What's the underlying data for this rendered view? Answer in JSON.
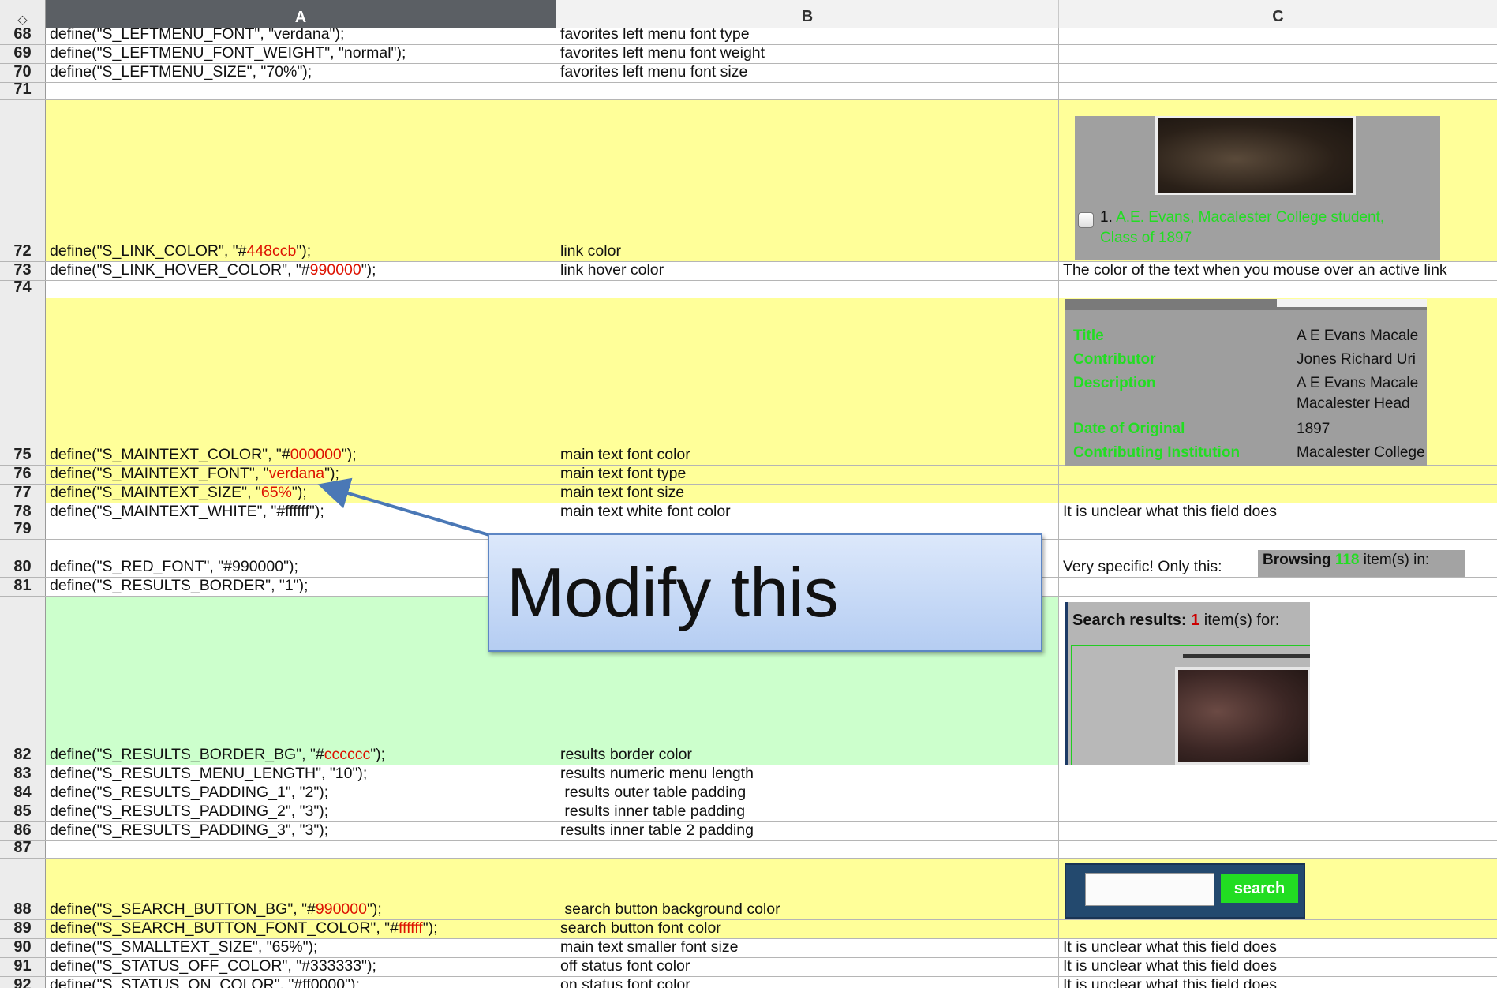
{
  "columns": {
    "corner": "◇",
    "a": "A",
    "b": "B",
    "c": "C"
  },
  "rows": {
    "r68": {
      "num": "68",
      "a": "define(\"S_LEFTMENU_FONT\", \"verdana\");",
      "b": "favorites left menu font type"
    },
    "r69": {
      "num": "69",
      "a": "define(\"S_LEFTMENU_FONT_WEIGHT\", \"normal\");",
      "b": "favorites left menu font weight"
    },
    "r70": {
      "num": "70",
      "a": "define(\"S_LEFTMENU_SIZE\", \"70%\");",
      "b": "favorites left menu font size"
    },
    "r71": {
      "num": "71"
    },
    "r72": {
      "num": "72",
      "a1": "define(\"S_LINK_COLOR\", \"#",
      "a2": "448ccb",
      "a3": "\");",
      "b": "link color"
    },
    "r73": {
      "num": "73",
      "a1": "define(\"S_LINK_HOVER_COLOR\", \"#",
      "a2": "990000",
      "a3": "\");",
      "b": "link hover color",
      "c": "The color of the text when you mouse over an active link"
    },
    "r74": {
      "num": "74"
    },
    "r75": {
      "num": "75",
      "a1": "define(\"S_MAINTEXT_COLOR\", \"#",
      "a2": "000000",
      "a3": "\");",
      "b": "main text font color"
    },
    "r76": {
      "num": "76",
      "a1": "define(\"S_MAINTEXT_FONT\", \"",
      "a2": "verdana",
      "a3": "\");",
      "b": "main text font type"
    },
    "r77": {
      "num": "77",
      "a1": "define(\"S_MAINTEXT_SIZE\", \"",
      "a2": "65%",
      "a3": "\");",
      "b": "main text font size"
    },
    "r78": {
      "num": "78",
      "a": "define(\"S_MAINTEXT_WHITE\", \"#ffffff\");",
      "b": "main text white font color",
      "c": "It is unclear what this field does"
    },
    "r79": {
      "num": "79"
    },
    "r80": {
      "num": "80",
      "a": "define(\"S_RED_FONT\", \"#990000\");",
      "c": "Very specific! Only this:"
    },
    "r81": {
      "num": "81",
      "a": "define(\"S_RESULTS_BORDER\", \"1\");"
    },
    "r82": {
      "num": "82",
      "a1": "define(\"S_RESULTS_BORDER_BG\", \"#",
      "a2": "cccccc",
      "a3": "\");",
      "b": "results border color"
    },
    "r83": {
      "num": "83",
      "a": "define(\"S_RESULTS_MENU_LENGTH\", \"10\");",
      "b": "results numeric menu length"
    },
    "r84": {
      "num": "84",
      "a": "define(\"S_RESULTS_PADDING_1\", \"2\");",
      "b": " results outer table padding"
    },
    "r85": {
      "num": "85",
      "a": "define(\"S_RESULTS_PADDING_2\", \"3\");",
      "b": " results inner table padding"
    },
    "r86": {
      "num": "86",
      "a": "define(\"S_RESULTS_PADDING_3\", \"3\");",
      "b": "results inner table 2 padding"
    },
    "r87": {
      "num": "87"
    },
    "r88": {
      "num": "88",
      "a1": "define(\"S_SEARCH_BUTTON_BG\", \"#",
      "a2": "990000",
      "a3": "\");",
      "b": " search button background color"
    },
    "r89": {
      "num": "89",
      "a1": "define(\"S_SEARCH_BUTTON_FONT_COLOR\", \"#",
      "a2": "ffffff",
      "a3": "\");",
      "b": "search button font color"
    },
    "r90": {
      "num": "90",
      "a": "define(\"S_SMALLTEXT_SIZE\", \"65%\");",
      "b": "main text smaller font size",
      "c": "It is unclear what this field does"
    },
    "r91": {
      "num": "91",
      "a": "define(\"S_STATUS_OFF_COLOR\", \"#333333\");",
      "b": "off status font color",
      "c": "It is unclear what this field does"
    },
    "r92": {
      "num": "92",
      "a": "define(\"S_STATUS_ON_COLOR\", \"#ff0000\");",
      "b": "on status font color",
      "c": "It is unclear what this field does"
    }
  },
  "preview_link": {
    "number": "1.",
    "text_line1": "A.E. Evans, Macalester College student,",
    "text_line2": "Class of 1897"
  },
  "preview_meta": [
    {
      "key": "Title",
      "value": "A E  Evans  Macale"
    },
    {
      "key": "Contributor",
      "value": "Jones  Richard Uri"
    },
    {
      "key": "Description",
      "value": "A E  Evans  Macale"
    },
    {
      "key": "",
      "value": "Macalester Head"
    },
    {
      "key": "Date of Original",
      "value": "1897"
    },
    {
      "key": "Contributing Institution",
      "value": "Macalester College"
    }
  ],
  "preview_browsing": {
    "label": "Browsing",
    "count": "118",
    "suffix": "item(s) in:"
  },
  "preview_results": {
    "label": "Search results:",
    "count": "1",
    "suffix": "item(s) for:"
  },
  "preview_search": {
    "button": "search"
  },
  "callout": {
    "text": "Modify this"
  },
  "colors": {
    "yellow": "#ffff99",
    "green": "#ccffcc",
    "header": "#5b5f64",
    "red": "#dd1100",
    "link_green": "#22dd22",
    "callout": "#c6d9f5"
  }
}
